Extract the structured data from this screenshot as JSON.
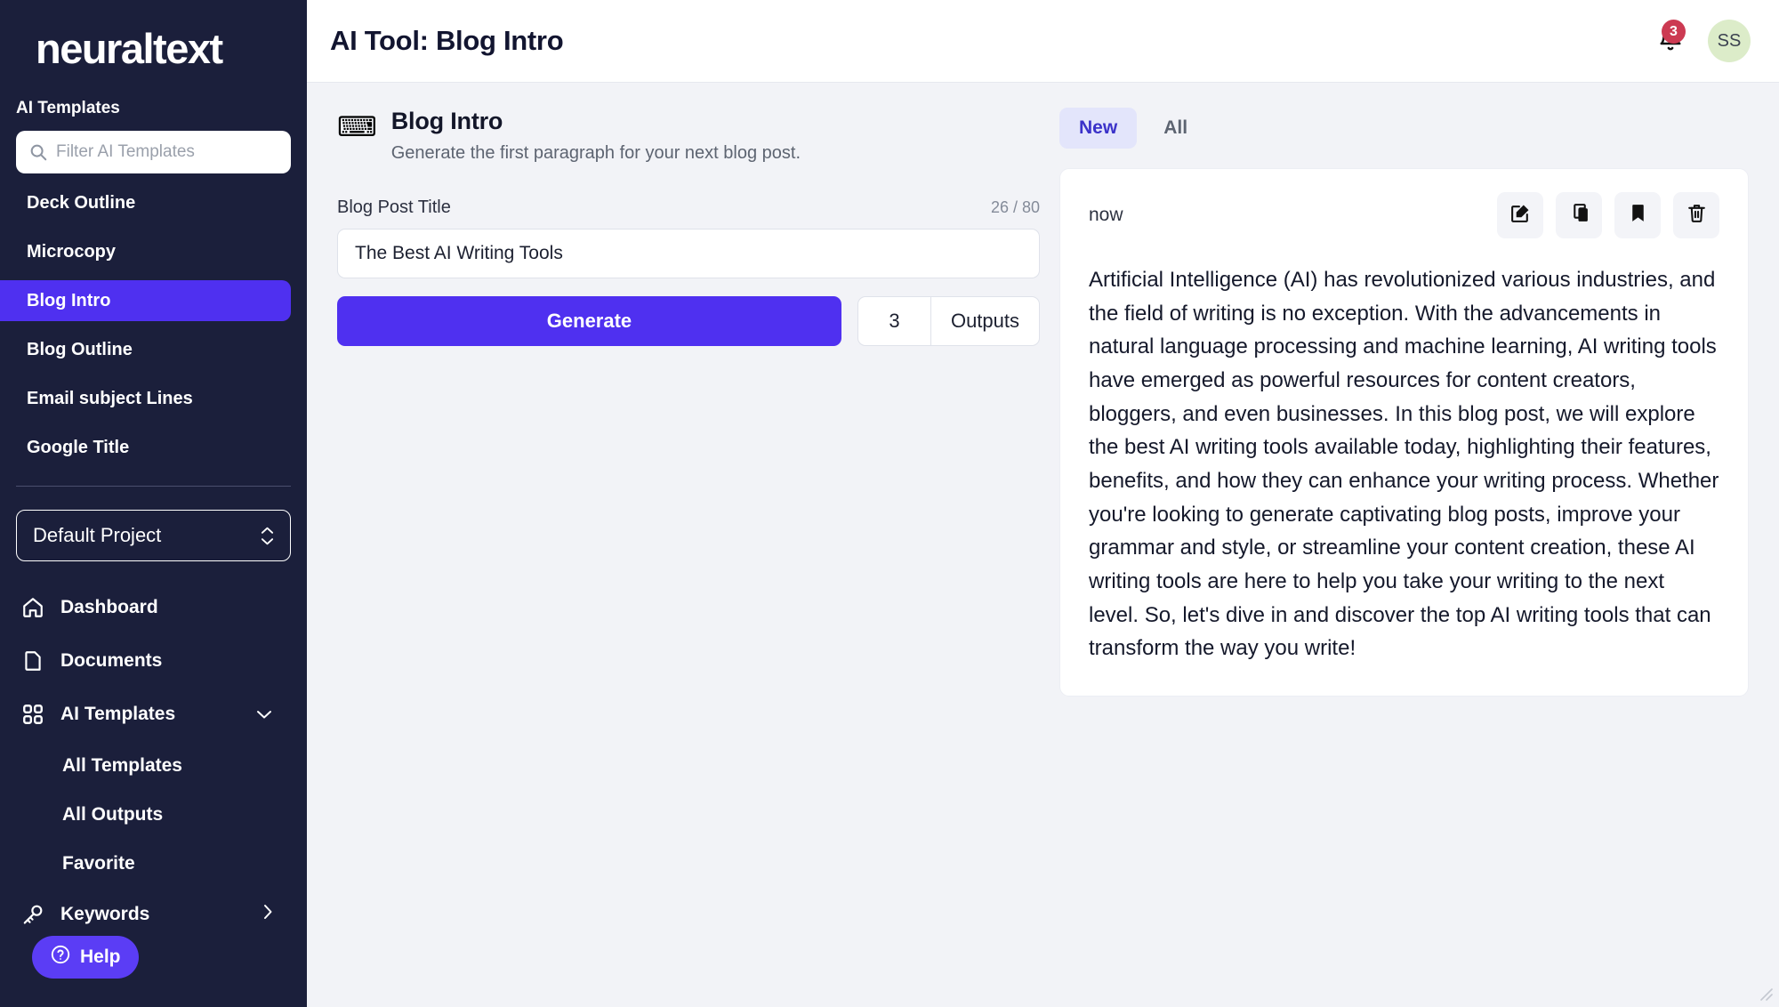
{
  "sidebar": {
    "logo": "neuraltext",
    "section_label": "AI Templates",
    "filter_placeholder": "Filter AI Templates",
    "templates": [
      {
        "label": "Deck Outline",
        "active": false
      },
      {
        "label": "Microcopy",
        "active": false
      },
      {
        "label": "Blog Intro",
        "active": true
      },
      {
        "label": "Blog Outline",
        "active": false
      },
      {
        "label": "Email subject Lines",
        "active": false
      },
      {
        "label": "Google Title",
        "active": false
      }
    ],
    "project": "Default Project",
    "nav": [
      {
        "label": "Dashboard",
        "icon": "home-icon"
      },
      {
        "label": "Documents",
        "icon": "document-icon"
      },
      {
        "label": "AI Templates",
        "icon": "grid-icon",
        "chevron": "down"
      }
    ],
    "nav_sub": [
      {
        "label": "All Templates"
      },
      {
        "label": "All Outputs"
      },
      {
        "label": "Favorite"
      }
    ],
    "keywords": {
      "label": "Keywords",
      "icon": "key-icon",
      "chevron": "right"
    },
    "help": {
      "label": "Help",
      "icon": "question-circle-icon"
    },
    "accent": "#4f30f0",
    "background": "#1b1f3b"
  },
  "topbar": {
    "title": "AI Tool: Blog Intro",
    "notification_count": "3",
    "avatar_initials": "SS",
    "badge_color": "#cc3a52",
    "avatar_color": "#dcecc9"
  },
  "tool": {
    "icon": "keyboard-icon",
    "icon_glyph": "⌨",
    "title": "Blog Intro",
    "subtitle": "Generate the first paragraph for your next blog post.",
    "field_label": "Blog Post Title",
    "counter": "26 / 80",
    "input_value": "The Best AI Writing Tools",
    "input_placeholder": "",
    "generate_label": "Generate",
    "outputs_count": "3",
    "outputs_label": "Outputs"
  },
  "results": {
    "tabs": [
      {
        "label": "New",
        "active": true
      },
      {
        "label": "All",
        "active": false
      }
    ],
    "cards": [
      {
        "timestamp": "now",
        "actions": [
          "edit-icon",
          "copy-icon",
          "bookmark-icon",
          "trash-icon"
        ],
        "text": "Artificial Intelligence (AI) has revolutionized various industries, and the field of writing is no exception. With the advancements in natural language processing and machine learning, AI writing tools have emerged as powerful resources for content creators, bloggers, and even businesses. In this blog post, we will explore the best AI writing tools available today, highlighting their features, benefits, and how they can enhance your writing process. Whether you're looking to generate captivating blog posts, improve your grammar and style, or streamline your content creation, these AI writing tools are here to help you take your writing to the next level. So, let's dive in and discover the top AI writing tools that can transform the way you write!"
      }
    ]
  }
}
